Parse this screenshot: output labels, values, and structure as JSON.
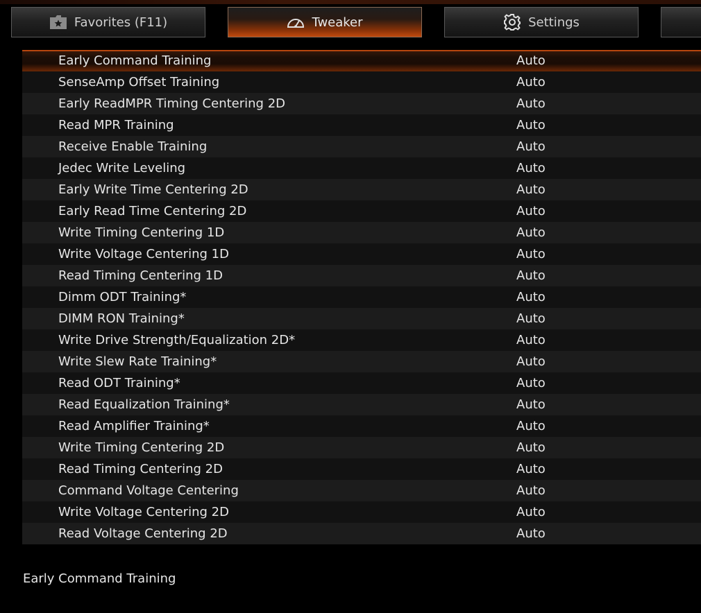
{
  "tabs": [
    {
      "label": "Favorites (F11)",
      "icon": "star-folder-icon"
    },
    {
      "label": "Tweaker",
      "icon": "speedometer-icon",
      "active": true
    },
    {
      "label": "Settings",
      "icon": "gear-icon"
    }
  ],
  "colors": {
    "accent": "#c04a0e",
    "background": "#000000",
    "row_light": "#1c1c1c",
    "row_dark": "#121212"
  },
  "rows": [
    {
      "label": "Early Command Training",
      "value": "Auto"
    },
    {
      "label": "SenseAmp Offset Training",
      "value": "Auto"
    },
    {
      "label": "Early ReadMPR Timing Centering 2D",
      "value": "Auto"
    },
    {
      "label": "Read MPR Training",
      "value": "Auto"
    },
    {
      "label": "Receive Enable Training",
      "value": "Auto"
    },
    {
      "label": "Jedec Write Leveling",
      "value": "Auto"
    },
    {
      "label": "Early Write Time Centering 2D",
      "value": "Auto"
    },
    {
      "label": "Early Read Time Centering 2D",
      "value": "Auto"
    },
    {
      "label": "Write Timing Centering 1D",
      "value": "Auto"
    },
    {
      "label": "Write Voltage Centering 1D",
      "value": "Auto"
    },
    {
      "label": "Read Timing Centering 1D",
      "value": "Auto"
    },
    {
      "label": "Dimm ODT Training*",
      "value": "Auto"
    },
    {
      "label": "DIMM RON Training*",
      "value": "Auto"
    },
    {
      "label": "Write Drive Strength/Equalization 2D*",
      "value": "Auto"
    },
    {
      "label": "Write Slew Rate Training*",
      "value": "Auto"
    },
    {
      "label": "Read ODT Training*",
      "value": "Auto"
    },
    {
      "label": "Read Equalization Training*",
      "value": "Auto"
    },
    {
      "label": "Read Amplifier Training*",
      "value": "Auto"
    },
    {
      "label": "Write Timing Centering 2D",
      "value": "Auto"
    },
    {
      "label": "Read Timing Centering 2D",
      "value": "Auto"
    },
    {
      "label": "Command Voltage Centering",
      "value": "Auto"
    },
    {
      "label": "Write Voltage Centering 2D",
      "value": "Auto"
    },
    {
      "label": "Read Voltage Centering 2D",
      "value": "Auto"
    }
  ],
  "help_text": "Early Command Training"
}
